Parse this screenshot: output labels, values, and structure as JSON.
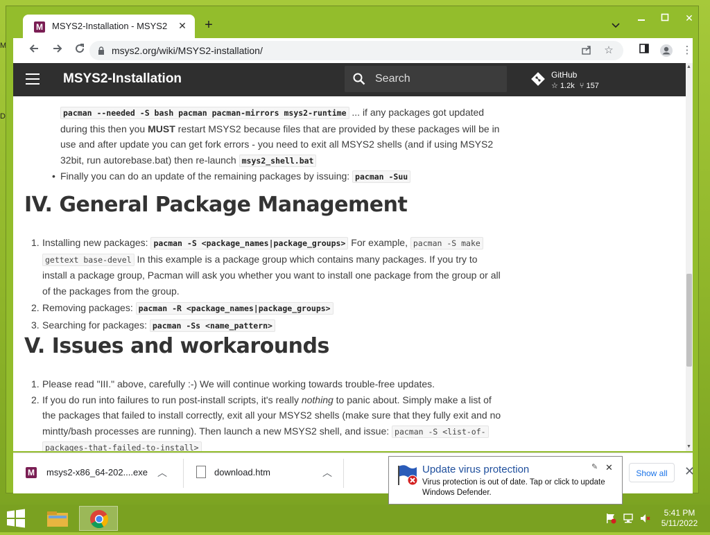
{
  "desktop": {
    "left_icon_letters": [
      "M",
      "D"
    ]
  },
  "browser": {
    "tab": {
      "favicon": "M",
      "title": "MSYS2-Installation - MSYS2"
    },
    "new_tab_icon": "plus-icon",
    "url": "msys2.org/wiki/MSYS2-installation/"
  },
  "site": {
    "title": "MSYS2-Installation",
    "search_placeholder": "Search",
    "github": {
      "name": "GitHub",
      "stars": "1.2k",
      "forks": "157"
    }
  },
  "content": {
    "p1_code": "pacman --needed -S bash pacman pacman-mirrors msys2-runtime",
    "p1_a": " ... if any packages got updated",
    "p1_b": "during this then you ",
    "p1_must": "MUST",
    "p1_c": " restart MSYS2 because files that are provided by these packages will be in",
    "p1_d": "use and after update you can get fork errors - you need to exit all MSYS2 shells (and if using MSYS2",
    "p1_e": "32bit, run autorebase.bat) then re-launch ",
    "p1_code2": "msys2_shell.bat",
    "p2_text": "Finally you can do an update of the remaining packages by issuing: ",
    "p2_code": "pacman -Suu",
    "h_general": "IV. General Package Management",
    "g1_a": "Installing new packages: ",
    "g1_code": "pacman -S <package_names|package_groups>",
    "g1_b": " For example, ",
    "g1_code2": "pacman -S make",
    "g1_code3": "gettext base-devel",
    "g1_c": " In this example is a package group which contains many packages. If you try to",
    "g1_d": "install a package group, Pacman will ask you whether you want to install one package from the group or all",
    "g1_e": "of the packages from the group.",
    "g2_a": "Removing packages: ",
    "g2_code": "pacman -R <package_names|package_groups>",
    "g3_a": "Searching for packages: ",
    "g3_code": "pacman -Ss <name_pattern>",
    "h_issues": "V. Issues and workarounds",
    "i1": "Please read \"III.\" above, carefully :-) We will continue working towards trouble-free updates.",
    "i2_a": "If you do run into failures to run post-install scripts, it's really ",
    "i2_em": "nothing",
    "i2_b": " to panic about. Simply make a list of",
    "i2_c": "the packages that failed to install correctly, exit all your MSYS2 shells (make sure that they fully exit and no",
    "i2_d": "mintty/bash processes are running). Then launch a new MSYS2 shell, and issue: ",
    "i2_code": "pacman -S <list-of-",
    "i2_code2": "packages-that-failed-to-install>"
  },
  "downloads": {
    "item1": "msys2-x86_64-202....exe",
    "item2": "download.htm",
    "show_all": "Show all"
  },
  "notification": {
    "title": "Update virus protection",
    "message": "Virus protection is out of date. Tap or click to update Windows Defender."
  },
  "taskbar": {
    "time": "5:41 PM",
    "date": "5/11/2022"
  }
}
